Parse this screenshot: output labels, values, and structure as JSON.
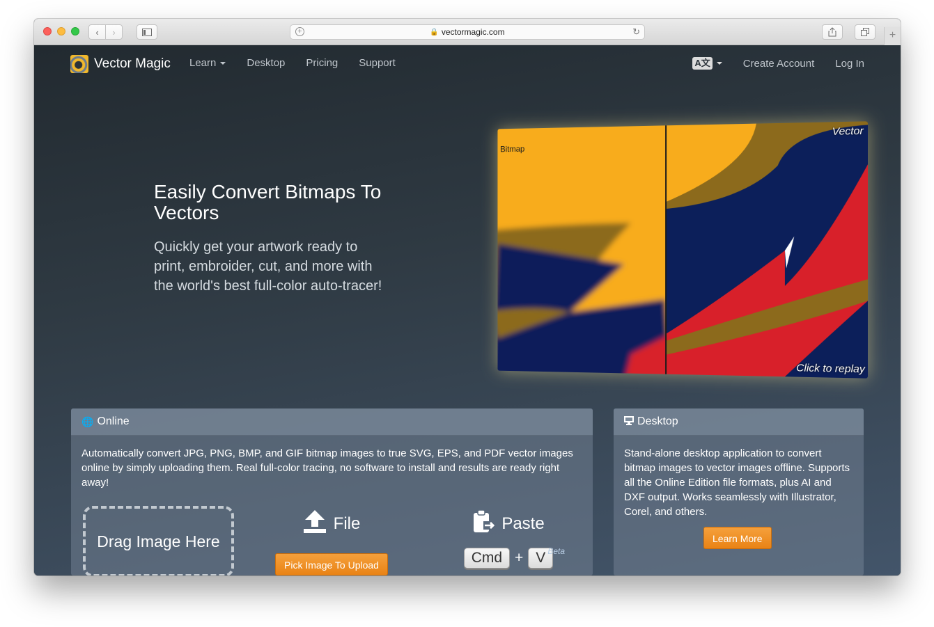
{
  "browser": {
    "url": "vectormagic.com"
  },
  "nav": {
    "brand": "Vector Magic",
    "links": [
      "Learn",
      "Desktop",
      "Pricing",
      "Support"
    ],
    "language_icon": "A文",
    "create_account": "Create Account",
    "login": "Log In"
  },
  "hero": {
    "title": "Easily Convert Bitmaps To Vectors",
    "subtitle": "Quickly get your artwork ready to print, embroider, cut, and more with the world's best full-color auto-tracer!",
    "demo": {
      "label_left": "Bitmap",
      "label_right": "Vector",
      "replay": "Click to replay"
    }
  },
  "online": {
    "title": "Online",
    "description": "Automatically convert JPG, PNG, BMP, and GIF bitmap images to true SVG, EPS, and PDF vector images online by simply uploading them. Real full-color tracing, no software to install and results are ready right away!",
    "drag": "Drag Image Here",
    "file_label": "File",
    "upload_button": "Pick Image To Upload",
    "paste_label": "Paste",
    "key_cmd": "Cmd",
    "key_plus": "+",
    "key_v": "V",
    "beta": "Beta"
  },
  "desktop": {
    "title": "Desktop",
    "description": "Stand-alone desktop application to convert bitmap images to vector images offline. Supports all the Online Edition file formats, plus AI and DXF output. Works seamlessly with Illustrator, Corel, and others.",
    "learn_more": "Learn More"
  },
  "colors": {
    "navy": "#0c1f5a",
    "gold": "#f8ac1c",
    "olive": "#8c6a1c",
    "red": "#d8202a",
    "orange_button": "#ef8f22"
  }
}
